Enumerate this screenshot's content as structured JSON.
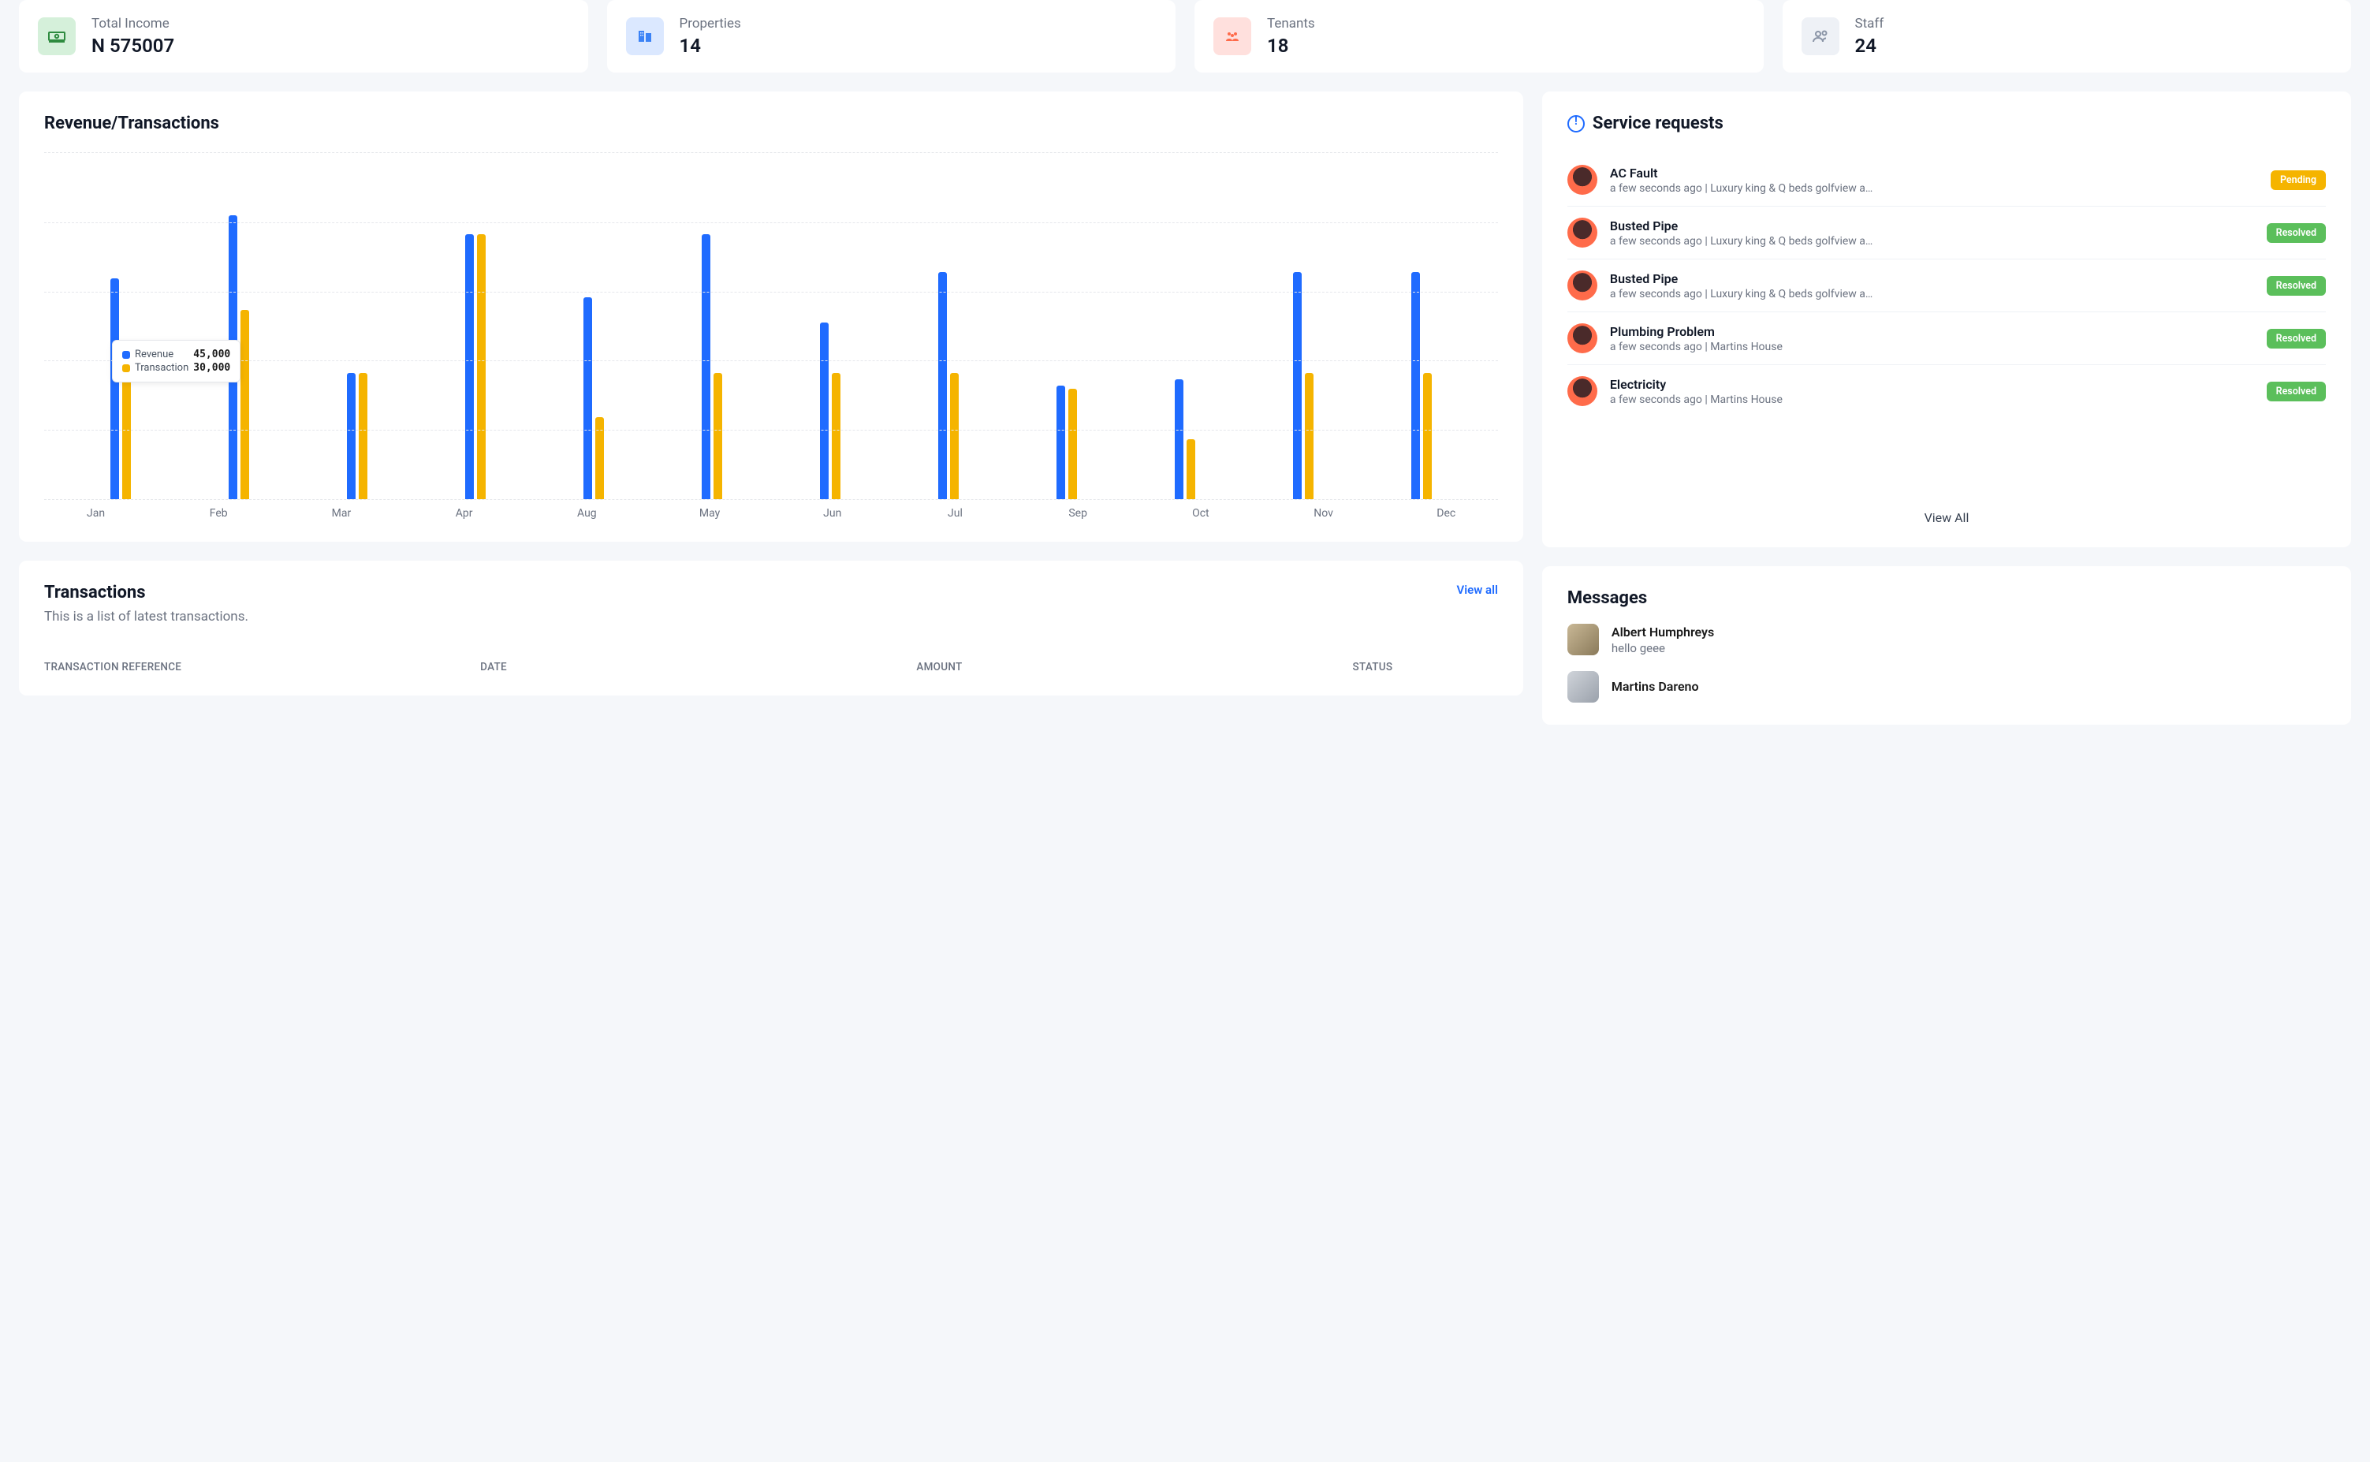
{
  "stats": [
    {
      "label": "Total Income",
      "value": "N 575007"
    },
    {
      "label": "Properties",
      "value": "14"
    },
    {
      "label": "Tenants",
      "value": "18"
    },
    {
      "label": "Staff",
      "value": "24"
    }
  ],
  "revenue_card": {
    "title": "Revenue/Transactions"
  },
  "chart_data": {
    "type": "bar",
    "categories": [
      "Jan",
      "Feb",
      "Mar",
      "Apr",
      "Aug",
      "May",
      "Jun",
      "Jul",
      "Sep",
      "Oct",
      "Nov",
      "Dec"
    ],
    "series": [
      {
        "name": "Revenue",
        "values": [
          35000,
          45000,
          20000,
          42000,
          32000,
          42000,
          28000,
          36000,
          18000,
          19000,
          36000,
          36000
        ]
      },
      {
        "name": "Transaction",
        "values": [
          20000,
          30000,
          20000,
          42000,
          13000,
          20000,
          20000,
          20000,
          17500,
          9500,
          20000,
          20000
        ]
      }
    ],
    "ylim": [
      0,
      55000
    ],
    "tooltip_month_index": 1,
    "tooltip": {
      "revenue": "45,000",
      "transaction": "30,000"
    }
  },
  "transactions_card": {
    "title": "Transactions",
    "subtitle": "This is a list of latest transactions.",
    "view_all": "View all",
    "columns": [
      "TRANSACTION REFERENCE",
      "DATE",
      "AMOUNT",
      "STATUS"
    ]
  },
  "service_requests": {
    "title": "Service requests",
    "view_all": "View All",
    "items": [
      {
        "title": "AC Fault",
        "sub": "a few seconds ago | Luxury king & Q beds golfview a…",
        "status": "Pending"
      },
      {
        "title": "Busted Pipe",
        "sub": "a few seconds ago | Luxury king & Q beds golfview a…",
        "status": "Resolved"
      },
      {
        "title": "Busted Pipe",
        "sub": "a few seconds ago | Luxury king & Q beds golfview a…",
        "status": "Resolved"
      },
      {
        "title": "Plumbing Problem",
        "sub": "a few seconds ago | Martins House",
        "status": "Resolved"
      },
      {
        "title": "Electricity",
        "sub": "a few seconds ago | Martins House",
        "status": "Resolved"
      }
    ]
  },
  "messages": {
    "title": "Messages",
    "items": [
      {
        "name": "Albert Humphreys",
        "preview": "hello geee"
      },
      {
        "name": "Martins Dareno",
        "preview": ""
      }
    ]
  }
}
